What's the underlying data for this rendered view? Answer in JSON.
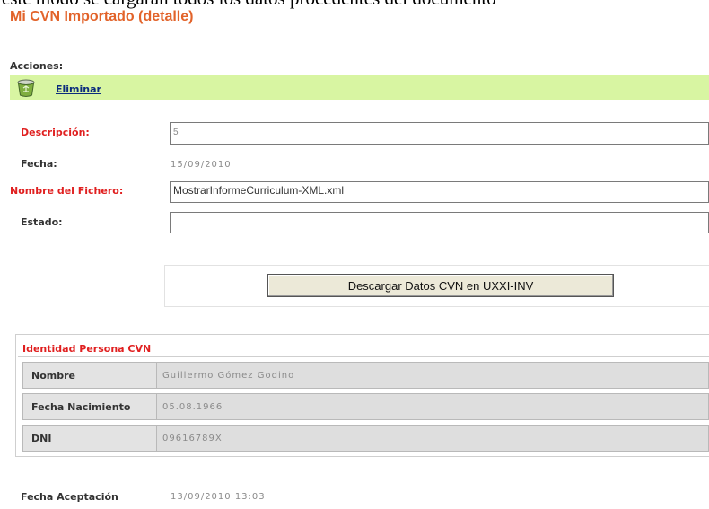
{
  "top_fragment": "este modo se cargarán todos los datos procedentes del documento",
  "title": "Mi CVN Importado (detalle)",
  "actions": {
    "label": "Acciones:",
    "delete_label": "Eliminar",
    "delete_icon": "recycle-bin-icon"
  },
  "form": {
    "descripcion_label": "Descripción:",
    "descripcion_value": "5",
    "fecha_label": "Fecha:",
    "fecha_value": "15/09/2010",
    "fichero_label": "Nombre del Fichero:",
    "fichero_value": "MostrarInformeCurriculum-XML.xml",
    "estado_label": "Estado:",
    "estado_value": ""
  },
  "download_button": "Descargar Datos CVN en UXXI-INV",
  "identity": {
    "title": "Identidad Persona CVN",
    "rows": [
      {
        "key": "Nombre",
        "value": "Guillermo Gómez Godino"
      },
      {
        "key": "Fecha Nacimiento",
        "value": "05.08.1966"
      },
      {
        "key": "DNI",
        "value": "09616789X"
      }
    ]
  },
  "acceptance": {
    "label": "Fecha Aceptación",
    "value": "13/09/2010 13:03"
  },
  "colors": {
    "title": "#e2632a",
    "required_label": "#e02020",
    "action_bar": "#d8f5a2",
    "link": "#0b2c7d"
  }
}
